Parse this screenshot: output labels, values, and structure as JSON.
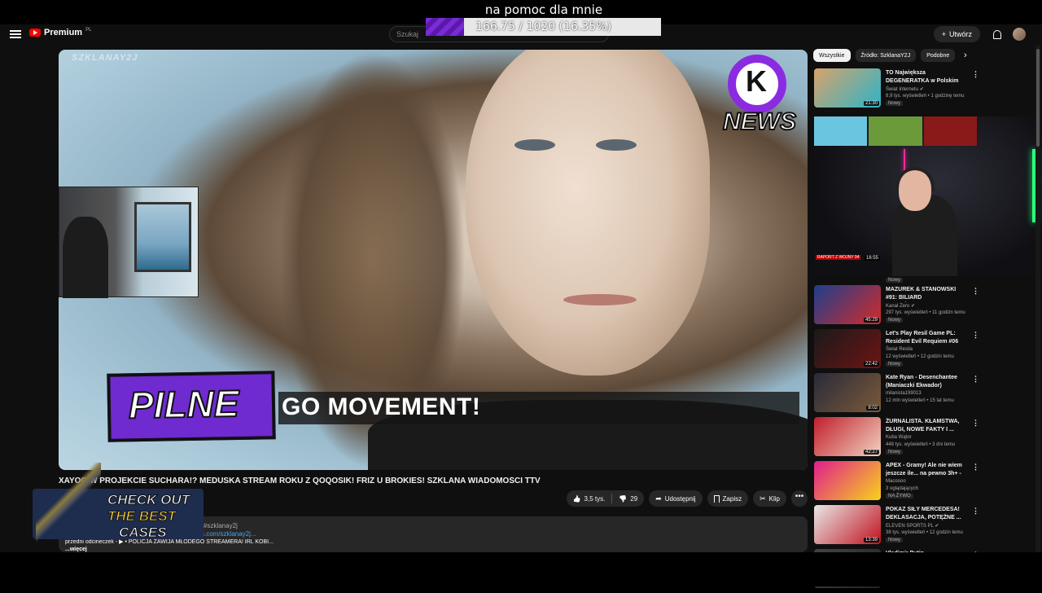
{
  "overlay": {
    "title": "na pomoc dla mnie",
    "progress_text": "166.75 / 1020 (16.35%)",
    "progress_fraction": 0.1635
  },
  "header": {
    "logo": "Premium",
    "logo_suffix": "PL",
    "search_placeholder": "Szukaj",
    "create_label": "Utwórz"
  },
  "video": {
    "watermark": "SZKLANAY2J",
    "news_badge": "NEWS",
    "lower_third": "PILNE",
    "ticker": "GO MOVEMENT!",
    "title": "XAYOO W PROJEKCIE SUCHARA!? MEDUSKA STREAM ROKU Z QOQOSIK! FRIZ U BROKIES! SZKLANA WIADOMOŚCI TTV",
    "likes": "3,5 tys.",
    "dislikes": "29",
    "share": "Udostępnij",
    "save": "Zapisz",
    "clip": "Klip",
    "more": "•••",
    "desc_hashtag": "#szklanay2j",
    "desc_link": "s.com/szklanay2j...",
    "desc_line": "przedni odcineczek - ▶ • POLICJA ZAWIJA MŁODEGO STREAMERA! IRL KOBI...",
    "desc_more": "...więcej"
  },
  "ad": {
    "line1": "CHECK OUT",
    "line2": "THE BEST",
    "line3": "CASES"
  },
  "sidebar": {
    "chips": [
      "Wszystkie",
      "Źródło: SzklanaY2J",
      "Podobne"
    ],
    "recs": [
      {
        "title": "TO Największa DEGENERATKA w Polskim Internecie",
        "channel": "Świat Internetu ✔",
        "meta": "8,9 tys. wyświetleń • 1 godzinę temu",
        "badge": "Nowy",
        "duration": "21:30",
        "c1": "#d8a36a",
        "c2": "#2db3c9"
      },
      {
        "title": "MAZUREK & STANOWSKI #91: BILIARD GLAPIŃSKIEGO, ...",
        "channel": "Kanał Zero ✔",
        "meta": "297 tys. wyświetleń • 11 godzin temu",
        "badge": "Nowy",
        "duration": "45:29",
        "c1": "#1d3f8c",
        "c2": "#d22b2b"
      },
      {
        "title": "Let's Play Resil Game PL: Resident Evil Requiem #06",
        "channel": "Świat Resila",
        "meta": "12 wyświetleń • 12 godzin temu",
        "badge": "Nowy",
        "duration": "22:42",
        "c1": "#1a1a1a",
        "c2": "#6d1414"
      },
      {
        "title": "Kate Ryan - Desenchantee (Maniaczki Ekwador)",
        "channel": "milanista199013",
        "meta": "12 mln wyświetleń • 15 lat temu",
        "badge": "",
        "duration": "8:02",
        "c1": "#2a2a3a",
        "c2": "#7a5a3a"
      },
      {
        "title": "ŻURNALISTA. KŁAMSTWA, DŁUGI, NOWE FAKTY I ...",
        "channel": "Kuba Wątor",
        "meta": "448 tys. wyświetleń • 3 dni temu",
        "badge": "Nowy",
        "duration": "42:27",
        "c1": "#c21e2c",
        "c2": "#f0d2c0"
      },
      {
        "title": "APEX - Gramy! Ale nie wiem jeszcze ile... na pewno 3h+ - ...",
        "channel": "Macoooo",
        "meta": "3 oglądających",
        "badge": "NA ŻYWO",
        "duration": "",
        "c1": "#e01e8c",
        "c2": "#f7d21e"
      },
      {
        "title": "POKAZ SIŁY MERCEDESA! DEKLASACJA, POTĘŻNE ...",
        "channel": "ELEVEN SPORTS PL ✔",
        "meta": "38 tys. wyświetleń • 12 godzin temu",
        "badge": "Nowy",
        "duration": "13:39",
        "c1": "#e8e8e8",
        "c2": "#c0121e"
      },
      {
        "title": "Vladimir Putin",
        "channel": "",
        "meta": "",
        "badge": "",
        "duration": "",
        "c1": "#444",
        "c2": "#222"
      }
    ],
    "streamer_label": "RAPORT Z WOJNY 94",
    "streamer_duration": "16:55",
    "streamer_badge": "Nowy"
  }
}
